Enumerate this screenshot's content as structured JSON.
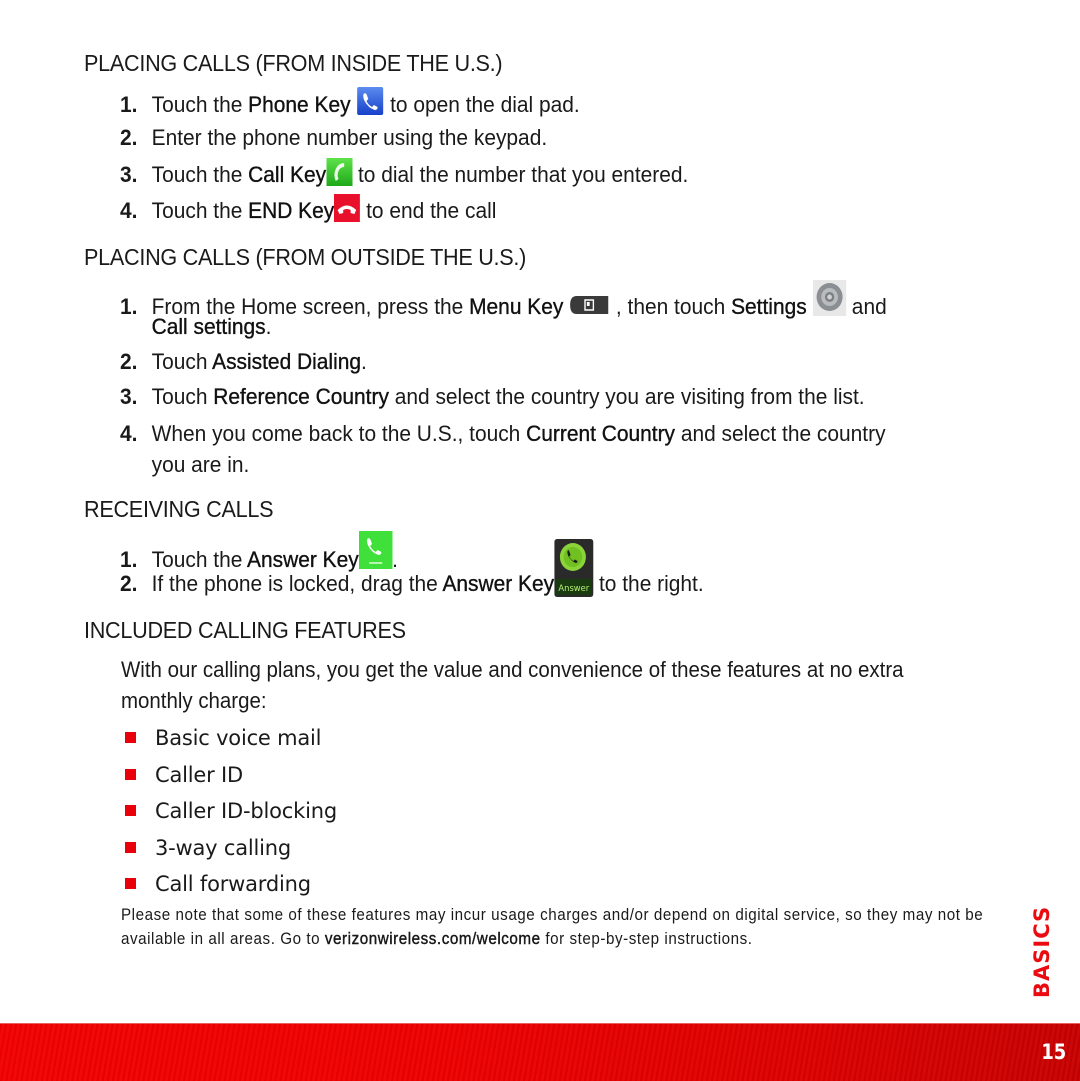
{
  "sections": {
    "inside_us": {
      "heading": "PLACING CALLS (FROM INSIDE THE U.S.)",
      "steps": [
        {
          "num": "1.",
          "pre": "Touch the ",
          "key": "Phone Key",
          "icon": "phone-key-icon",
          "post": " to open the dial pad."
        },
        {
          "num": "2.",
          "text": "Enter the phone number using the keypad."
        },
        {
          "num": "3.",
          "pre": "Touch the ",
          "key": "Call Key",
          "icon": "call-key-icon",
          "post": " to dial the number that you entered."
        },
        {
          "num": "4.",
          "pre": "Touch the ",
          "key": "END Key",
          "icon": "end-key-icon",
          "post": " to end the call"
        }
      ]
    },
    "outside_us": {
      "heading": "PLACING CALLS (FROM OUTSIDE THE U.S.)",
      "steps": [
        {
          "num": "1.",
          "pre": "From the Home screen, press the ",
          "key": "Menu Key",
          "icon": "menu-key-icon",
          "mid": " , then touch ",
          "key2": "Settings",
          "icon2": "settings-icon",
          "post": " and",
          "line2_key": "Call settings",
          "line2_post": "."
        },
        {
          "num": "2.",
          "pre": "Touch ",
          "key": "Assisted Dialing",
          "post": "."
        },
        {
          "num": "3.",
          "pre": "Touch ",
          "key": "Reference Country",
          "post": " and select the country you are visiting from the list."
        },
        {
          "num": "4.",
          "pre": "When you come back to the U.S., touch ",
          "key": "Current Country",
          "post": " and select the country",
          "line2": "you are in."
        }
      ]
    },
    "receiving": {
      "heading": "RECEIVING CALLS",
      "steps": [
        {
          "num": "1.",
          "pre": "Touch the ",
          "key": "Answer Key",
          "icon": "answer-key-icon",
          "post": "."
        },
        {
          "num": "2.",
          "pre": "If the phone is locked, drag the ",
          "key": "Answer Key",
          "icon": "answer-slider-icon",
          "icon_label": "Answer",
          "post": " to the right."
        }
      ]
    },
    "features": {
      "heading": "INCLUDED CALLING FEATURES",
      "intro_line1": "With our calling plans, you get the value and convenience of these features at no extra",
      "intro_line2": "monthly charge:",
      "items": [
        "Basic voice mail",
        "Caller ID",
        "Caller ID-blocking",
        "3-way calling",
        "Call forwarding"
      ],
      "note_pre": "Please note that some of these features may incur usage charges and/or depend on digital service, so they may not be available in all areas. Go to ",
      "note_link": "verizonwireless.com/welcome",
      "note_post": " for step-by-step instructions."
    }
  },
  "side_tab": "BASICS",
  "page_number": "15",
  "colors": {
    "accent": "#ea0a0f",
    "footer": "#ee0000",
    "bullet": "#e8000b"
  }
}
